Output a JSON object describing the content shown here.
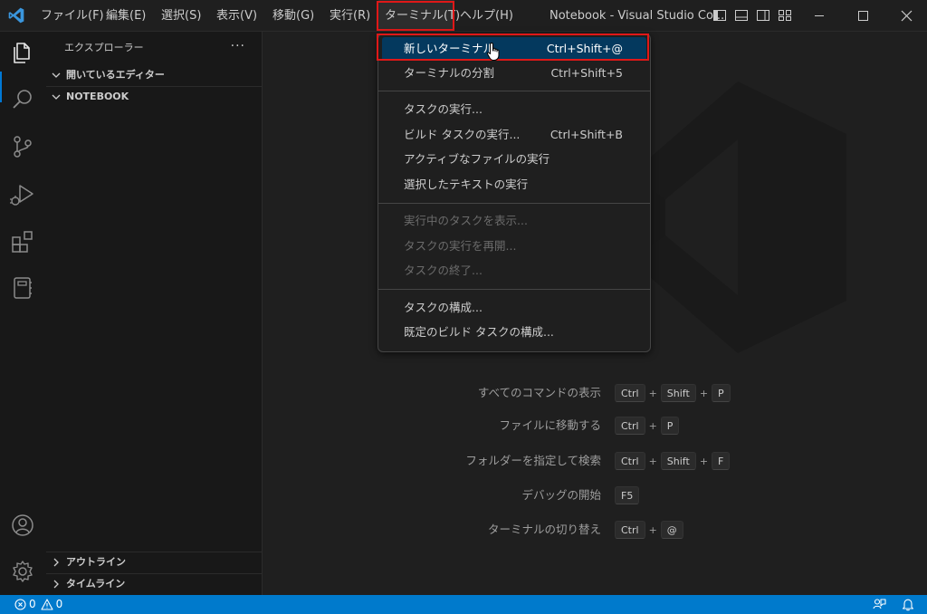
{
  "window": {
    "title": "Notebook - Visual Studio Co..."
  },
  "menubar": {
    "items": [
      {
        "label": "ファイル(F)"
      },
      {
        "label": "編集(E)"
      },
      {
        "label": "選択(S)"
      },
      {
        "label": "表示(V)"
      },
      {
        "label": "移動(G)"
      },
      {
        "label": "実行(R)"
      },
      {
        "label": "ターミナル(T)"
      },
      {
        "label": "ヘルプ(H)"
      }
    ],
    "active": "ターミナル(T)"
  },
  "sidebar": {
    "title": "エクスプローラー",
    "more": "···",
    "sections": {
      "open_editors": "開いているエディター",
      "notebook": "NOTEBOOK",
      "outline": "アウトライン",
      "timeline": "タイムライン"
    }
  },
  "terminal_menu": {
    "items": [
      {
        "label": "新しいターミナル",
        "shortcut": "Ctrl+Shift+@",
        "state": "highlighted"
      },
      {
        "label": "ターミナルの分割",
        "shortcut": "Ctrl+Shift+5",
        "state": "enabled"
      },
      {
        "label": "タスクの実行...",
        "shortcut": "",
        "state": "enabled"
      },
      {
        "label": "ビルド タスクの実行...",
        "shortcut": "Ctrl+Shift+B",
        "state": "enabled"
      },
      {
        "label": "アクティブなファイルの実行",
        "shortcut": "",
        "state": "enabled"
      },
      {
        "label": "選択したテキストの実行",
        "shortcut": "",
        "state": "enabled"
      },
      {
        "label": "実行中のタスクを表示...",
        "shortcut": "",
        "state": "disabled"
      },
      {
        "label": "タスクの実行を再開...",
        "shortcut": "",
        "state": "disabled"
      },
      {
        "label": "タスクの終了...",
        "shortcut": "",
        "state": "disabled"
      },
      {
        "label": "タスクの構成...",
        "shortcut": "",
        "state": "enabled"
      },
      {
        "label": "既定のビルド タスクの構成...",
        "shortcut": "",
        "state": "enabled"
      }
    ]
  },
  "editor": {
    "shortcuts": [
      {
        "label": "すべてのコマンドの表示",
        "keys": [
          "Ctrl",
          "Shift",
          "P"
        ]
      },
      {
        "label": "ファイルに移動する",
        "keys": [
          "Ctrl",
          "P"
        ]
      },
      {
        "label": "フォルダーを指定して検索",
        "keys": [
          "Ctrl",
          "Shift",
          "F"
        ]
      },
      {
        "label": "デバッグの開始",
        "keys": [
          "F5"
        ]
      },
      {
        "label": "ターミナルの切り替え",
        "keys": [
          "Ctrl",
          "@"
        ]
      }
    ],
    "plus": "+"
  },
  "statusbar": {
    "errors": "0",
    "warnings": "0"
  },
  "colors": {
    "accent": "#007acc",
    "highlight": "#04395e",
    "annotation": "#e01818"
  },
  "icons": {
    "activity": [
      "explorer-icon",
      "search-icon",
      "source-control-icon",
      "run-debug-icon",
      "extensions-icon",
      "notebook-icon",
      "account-icon",
      "settings-gear-icon"
    ]
  }
}
